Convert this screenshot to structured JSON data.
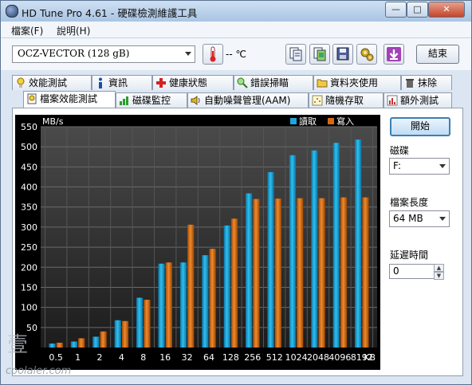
{
  "window": {
    "title": "HD Tune Pro 4.61 - 硬碟檢測維護工具"
  },
  "menu": {
    "file": "檔案(F)",
    "help": "說明(H)"
  },
  "toolbar": {
    "drive": "OCZ-VECTOR (128 gB)",
    "temperature": "-- ℃",
    "exit_label": "結束"
  },
  "tabs_row1": [
    {
      "label": "效能測試",
      "icon": "benchmark-icon"
    },
    {
      "label": "資訊",
      "icon": "info-icon"
    },
    {
      "label": "健康狀態",
      "icon": "health-icon"
    },
    {
      "label": "錯誤掃瞄",
      "icon": "error-scan-icon"
    },
    {
      "label": "資料夾使用",
      "icon": "folder-icon"
    },
    {
      "label": "抹除",
      "icon": "trash-icon"
    }
  ],
  "tabs_row2": [
    {
      "label": "檔案效能測試",
      "icon": "file-benchmark-icon"
    },
    {
      "label": "磁碟監控",
      "icon": "disk-monitor-icon"
    },
    {
      "label": "自動噪聲管理(AAM)",
      "icon": "speaker-icon"
    },
    {
      "label": "隨機存取",
      "icon": "random-access-icon"
    },
    {
      "label": "額外測試",
      "icon": "extra-tests-icon"
    }
  ],
  "right_panel": {
    "start_label": "開始",
    "drive_label": "磁碟",
    "drive_value": "F:",
    "length_label": "檔案長度",
    "length_value": "64 MB",
    "delay_label": "延遲時間",
    "delay_value": "0"
  },
  "chart_data": {
    "type": "bar",
    "ylabel": "MB/s",
    "xunit": "KB",
    "ylim": [
      0,
      550
    ],
    "yticks": [
      50,
      100,
      150,
      200,
      250,
      300,
      350,
      400,
      450,
      500,
      550
    ],
    "grid": true,
    "legend_position": "top-right",
    "categories": [
      "0.5",
      "1",
      "2",
      "4",
      "8",
      "16",
      "32",
      "64",
      "128",
      "256",
      "512",
      "1024",
      "2048",
      "4096",
      "8192"
    ],
    "series": [
      {
        "name": "讀取",
        "color": "#1fa6dc",
        "values": [
          10,
          15,
          27,
          68,
          124,
          209,
          212,
          230,
          304,
          384,
          437,
          479,
          491,
          510,
          518
        ]
      },
      {
        "name": "寫入",
        "color": "#d56a12",
        "values": [
          12,
          23,
          40,
          66,
          119,
          212,
          306,
          246,
          321,
          370,
          371,
          372,
          372,
          374,
          374
        ]
      }
    ]
  },
  "watermark": {
    "text": "coolaler.com"
  }
}
